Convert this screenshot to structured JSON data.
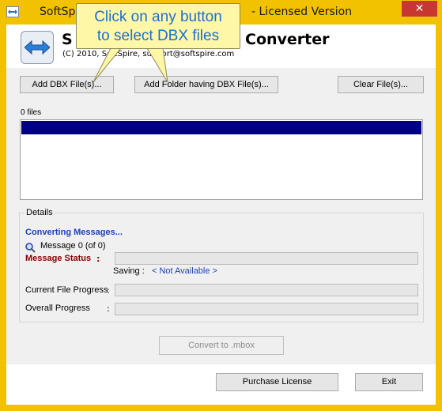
{
  "window": {
    "title_left": "SoftSp",
    "title_right": "- Licensed Version",
    "close_label": "✕"
  },
  "header": {
    "app_title_left": "S",
    "app_title_right": "Converter",
    "copyright": "(C) 2010, SoftSpire, support@softspire.com"
  },
  "callout": {
    "line1": "Click on any button",
    "line2": "to select DBX files"
  },
  "toolbar": {
    "add_files_label": "Add DBX File(s)...",
    "add_folder_label": "Add Folder having DBX File(s)...",
    "clear_label": "Clear File(s)..."
  },
  "files": {
    "count_label": "0 files"
  },
  "details": {
    "legend": "Details",
    "converting_label": "Converting Messages...",
    "message_count": "Message 0 (of 0)",
    "status_label": "Message Status",
    "status_colon": ":",
    "saving_label": "Saving :",
    "saving_value": "< Not Available >",
    "current_progress_label": "Current File Progress",
    "overall_progress_label": "Overall Progress",
    "colon": ":"
  },
  "actions": {
    "convert_label": "Convert to .mbox",
    "purchase_label": "Purchase License",
    "exit_label": "Exit"
  },
  "icons": {
    "app": "double-arrow-icon",
    "logo": "double-arrow-icon",
    "search": "magnifier-icon"
  },
  "colors": {
    "title_bar": "#f2c200",
    "selection": "#000080",
    "callout_bg": "#fff7a8",
    "callout_text": "#1a6fd1",
    "status_label": "#8b0000",
    "link_blue": "#1f3fbf"
  }
}
